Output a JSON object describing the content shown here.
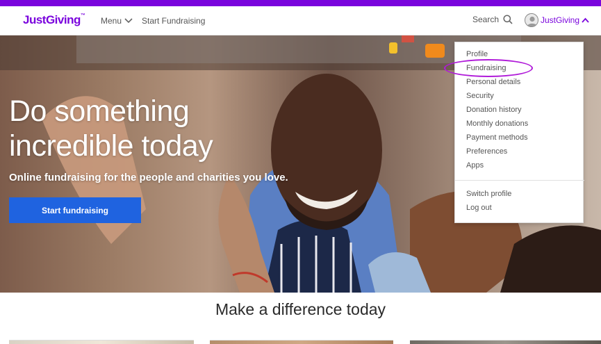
{
  "header": {
    "logo": "JustGiving",
    "logo_tm": "™",
    "menu_label": "Menu",
    "start_label": "Start Fundraising",
    "search_label": "Search",
    "account_label": "JustGiving"
  },
  "hero": {
    "headline_line1": "Do something",
    "headline_line2": "incredible today",
    "subtitle": "Online fundraising for the people and charities you love.",
    "cta_label": "Start fundraising"
  },
  "account_menu": {
    "items": [
      "Profile",
      "Fundraising",
      "Personal details",
      "Security",
      "Donation history",
      "Monthly donations",
      "Payment methods",
      "Preferences",
      "Apps"
    ],
    "secondary_items": [
      "Switch profile",
      "Log out"
    ],
    "highlighted_item": "Fundraising"
  },
  "section": {
    "title": "Make a difference today"
  },
  "colors": {
    "brand": "#7a04dd",
    "cta": "#1f63e0",
    "highlight_ring": "#b01bd9"
  },
  "icons": {
    "search": "search-icon",
    "menu_chevron": "chevron-down-icon",
    "account_chevron": "chevron-up-icon",
    "avatar": "avatar-icon"
  }
}
